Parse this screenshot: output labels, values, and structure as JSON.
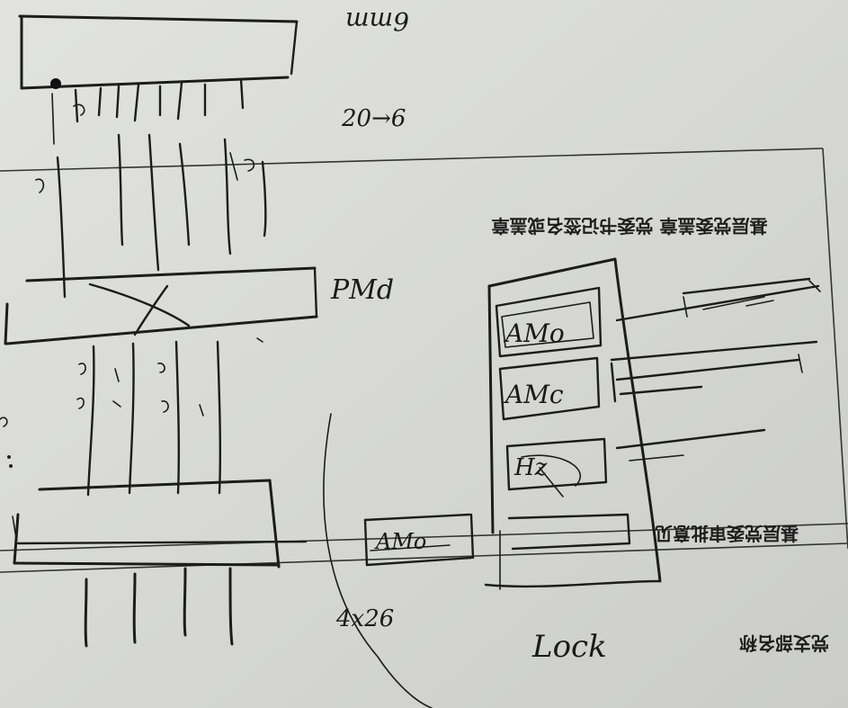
{
  "handwritten": {
    "top_right_note": "6mm",
    "mid_note": "20→6",
    "label_pmd": "PMd",
    "label_amo_1": "AMo",
    "label_amo_2": "AMc",
    "label_hz": "Hz",
    "label_amo_3": "AMo",
    "label_dim": "4x26",
    "label_lock": "Lock"
  },
  "printed": {
    "heading_1": "基层党委盖章 党委书记签名或盖章",
    "heading_2": "基层党委审批意见",
    "heading_3": "党支部名称"
  }
}
